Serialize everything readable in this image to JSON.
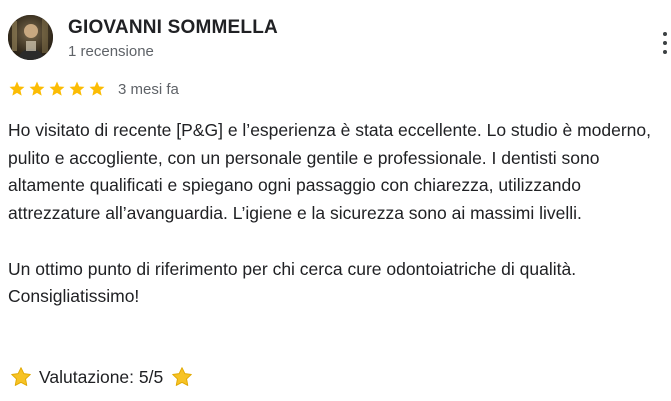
{
  "author": {
    "name": "GIOVANNI SOMMELLA",
    "review_count": "1 recensione",
    "avatar_icon": "user-avatar-photo"
  },
  "rating": {
    "stars": 5,
    "max_stars": 5,
    "star_color": "#fbbc04",
    "date": "3 mesi fa"
  },
  "review": {
    "paragraph1": "Ho visitato di recente [P&G] e l’esperienza è stata eccellente. Lo studio è moderno, pulito e accogliente, con un personale gentile e professionale. I dentisti sono altamente qualificati e spiegano ogni passaggio con chiarezza, utilizzando attrezzature all’avanguardia. L’igiene e la sicurezza sono ai massimi livelli.",
    "paragraph2": "Un ottimo punto di riferimento per chi cerca cure odontoiatriche di qualità. Consigliatissimo!",
    "score_line": "Valutazione: 5/5"
  },
  "menu": {
    "icon": "more-vertical-icon"
  }
}
